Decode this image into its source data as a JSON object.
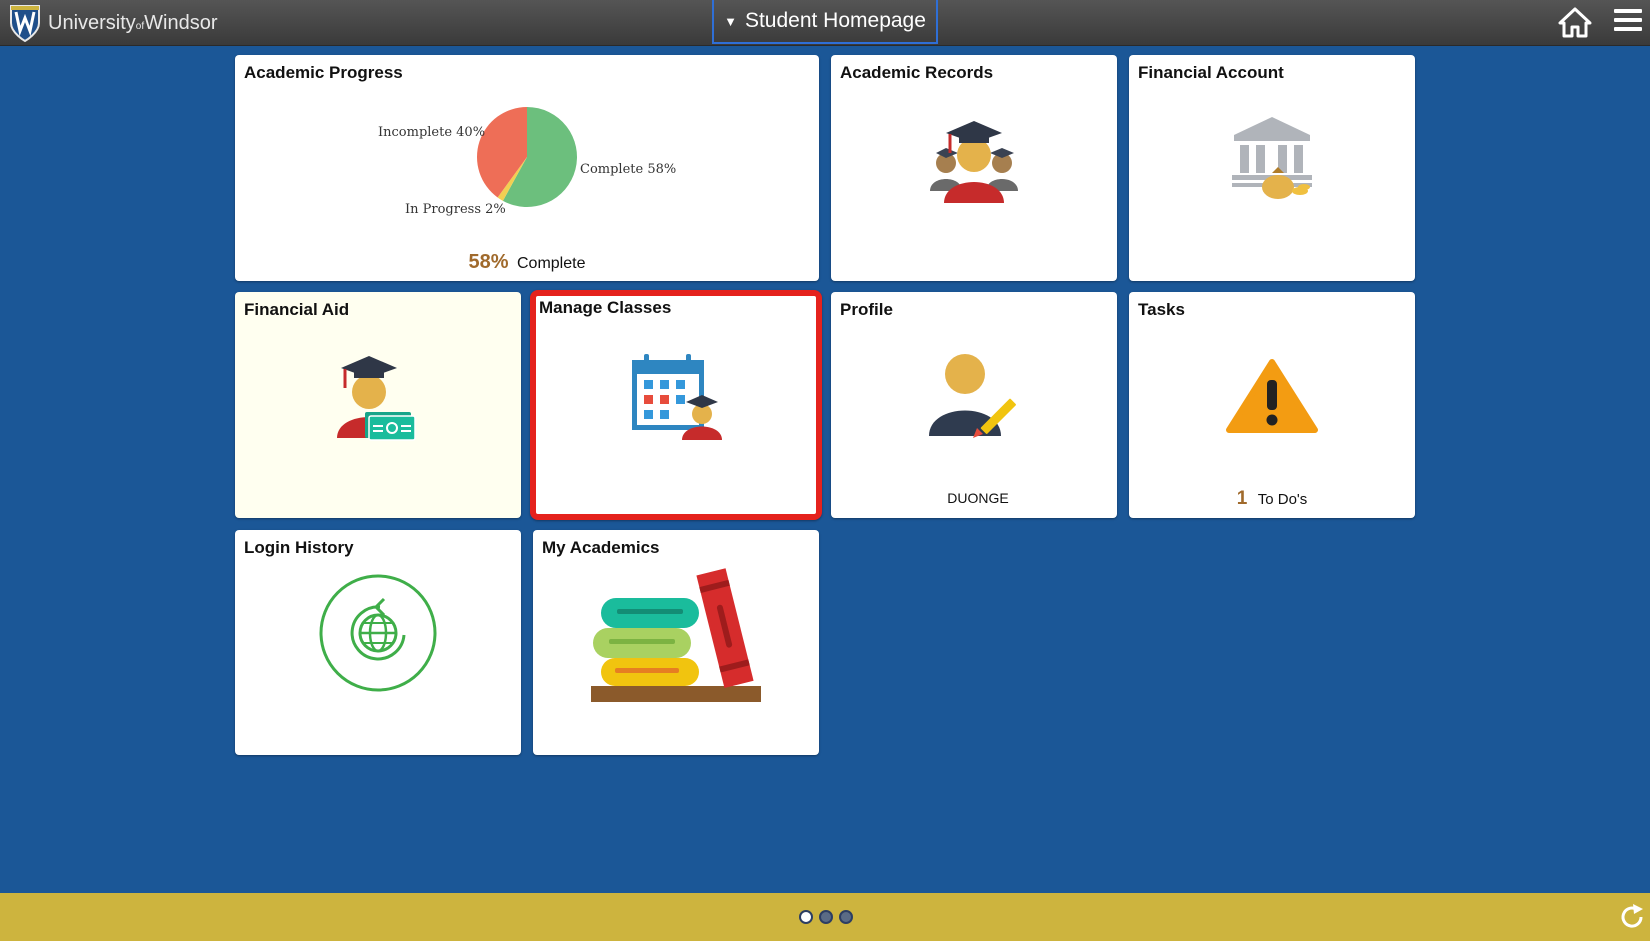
{
  "header": {
    "logo_text_1": "University",
    "logo_text_of": "of",
    "logo_text_2": "Windsor",
    "title": "Student Homepage",
    "home_icon": "home-icon",
    "menu_icon": "hamburger-menu-icon"
  },
  "tiles": {
    "academic_progress": {
      "title": "Academic Progress",
      "chart_data": {
        "type": "pie",
        "categories": [
          "Complete",
          "Incomplete",
          "In Progress"
        ],
        "values": [
          58,
          40,
          2
        ],
        "labels": [
          "Complete 58%",
          "Incomplete 40%",
          "In Progress 2%"
        ],
        "colors": [
          "#6cbf7d",
          "#ee6e57",
          "#f2cf52"
        ]
      },
      "percent": "58%",
      "percent_label": "Complete"
    },
    "academic_records": {
      "title": "Academic Records",
      "icon": "graduates-icon"
    },
    "financial_account": {
      "title": "Financial Account",
      "icon": "bank-icon"
    },
    "financial_aid": {
      "title": "Financial Aid",
      "icon": "graduate-money-icon"
    },
    "manage_classes": {
      "title": "Manage Classes",
      "icon": "calendar-student-icon"
    },
    "profile": {
      "title": "Profile",
      "icon": "profile-edit-icon",
      "name": "DUONGE"
    },
    "tasks": {
      "title": "Tasks",
      "icon": "warning-icon",
      "count": "1",
      "count_label": "To Do's"
    },
    "login_history": {
      "title": "Login History",
      "icon": "globe-history-icon"
    },
    "my_academics": {
      "title": "My Academics",
      "icon": "books-icon"
    }
  },
  "footer": {
    "page_dots": 3,
    "active_dot": 0,
    "refresh_icon": "refresh-icon"
  },
  "colors": {
    "background": "#1b5797",
    "footer": "#cdb43e",
    "selected_border": "#e5221d",
    "accent_number": "#a06a2c"
  }
}
